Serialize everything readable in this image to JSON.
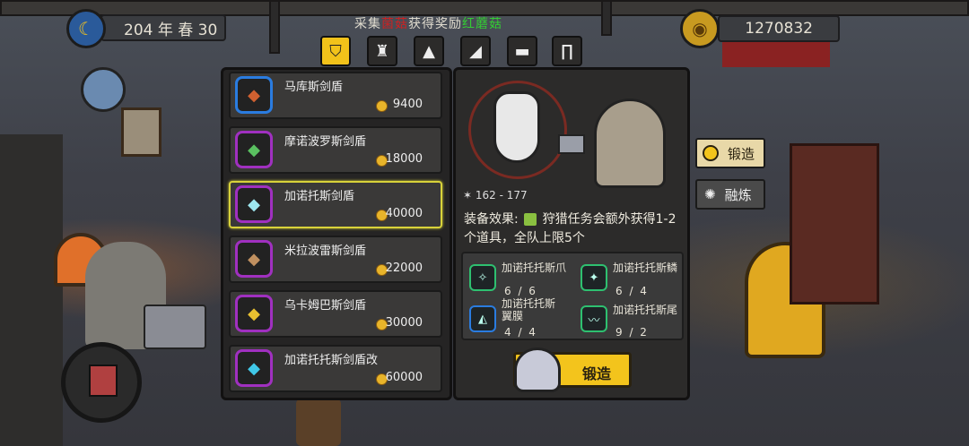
{
  "hud": {
    "date": "204 年 春 30",
    "gold": "1270832"
  },
  "quest": {
    "prefix": "采集",
    "target": "菌菇",
    "middle": "获得奖励",
    "reward": "红蘑菇"
  },
  "tabs": [
    "shield-tab-icon",
    "helmet-tab-icon",
    "armor-tab-icon",
    "weapon-tab-icon",
    "shoulder-tab-icon",
    "boots-tab-icon"
  ],
  "items": [
    {
      "name": "马库斯剑盾",
      "price": "9400",
      "rarity_color": "#2a7ce0"
    },
    {
      "name": "摩诺波罗斯剑盾",
      "price": "18000",
      "rarity_color": "#a030c0"
    },
    {
      "name": "加诺托斯剑盾",
      "price": "40000",
      "rarity_color": "#a030c0"
    },
    {
      "name": "米拉波雷斯剑盾",
      "price": "22000",
      "rarity_color": "#a030c0"
    },
    {
      "name": "乌卡姆巴斯剑盾",
      "price": "30000",
      "rarity_color": "#a030c0"
    },
    {
      "name": "加诺托托斯剑盾改",
      "price": "60000",
      "rarity_color": "#a030c0"
    }
  ],
  "detail": {
    "stat": "162 - 177",
    "effect_label": "装备效果:",
    "effect_text": "狩猎任务会额外获得1-2个道具，全队上限5个",
    "materials": [
      {
        "name": "加诺托托斯爪",
        "count": "6 / 6",
        "color": "#2ec070"
      },
      {
        "name": "加诺托托斯鳞",
        "count": "6 / 4",
        "color": "#2ec070"
      },
      {
        "name": "加诺托托斯翼膜",
        "count": "4 / 4",
        "color": "#2a7ce0"
      },
      {
        "name": "加诺托托斯尾",
        "count": "9 / 2",
        "color": "#2ec070"
      }
    ],
    "forge_label": "锻造"
  },
  "side": {
    "forge": "锻造",
    "refine": "融炼"
  },
  "colors": {
    "accent": "#f3c41c",
    "selected": "#d8d23a"
  }
}
